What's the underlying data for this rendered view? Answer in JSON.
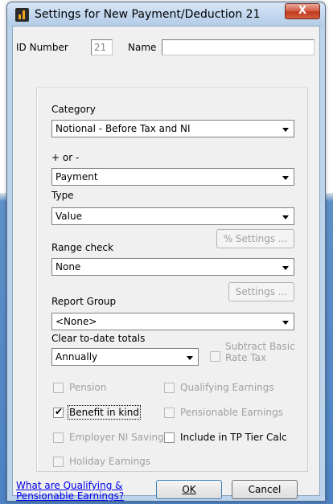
{
  "window": {
    "title": "Settings for New Payment/Deduction  21",
    "close_label": "X"
  },
  "header": {
    "id_label": "ID Number",
    "id_value": "21",
    "name_label": "Name",
    "name_value": ""
  },
  "fields": {
    "category_label": "Category",
    "category_value": "Notional - Before Tax and NI",
    "sign_label": "+ or -",
    "sign_value": "Payment",
    "type_label": "Type",
    "type_value": "Value",
    "range_label": "Range check",
    "range_value": "None",
    "percent_settings_label": "% Settings ...",
    "report_group_label": "Report Group",
    "report_group_value": "<None>",
    "settings_label": "Settings ...",
    "clear_label": "Clear to-date totals",
    "clear_value": "Annually",
    "subtract_basic_line1": "Subtract Basic",
    "subtract_basic_line2": "Rate Tax"
  },
  "checkboxes": {
    "pension": "Pension",
    "qualifying_earnings": "Qualifying Earnings",
    "benefit_in_kind": "Benefit in kind",
    "pensionable_earnings": "Pensionable Earnings",
    "employer_ni_saving": "Employer NI Saving",
    "include_tp_tier": "Include in TP Tier Calc",
    "holiday_earnings": "Holiday Earnings"
  },
  "footer": {
    "link_line1": "What are Qualifying &",
    "link_line2": "Pensionable Earnings?",
    "ok_label": "OK",
    "cancel_label": "Cancel"
  }
}
